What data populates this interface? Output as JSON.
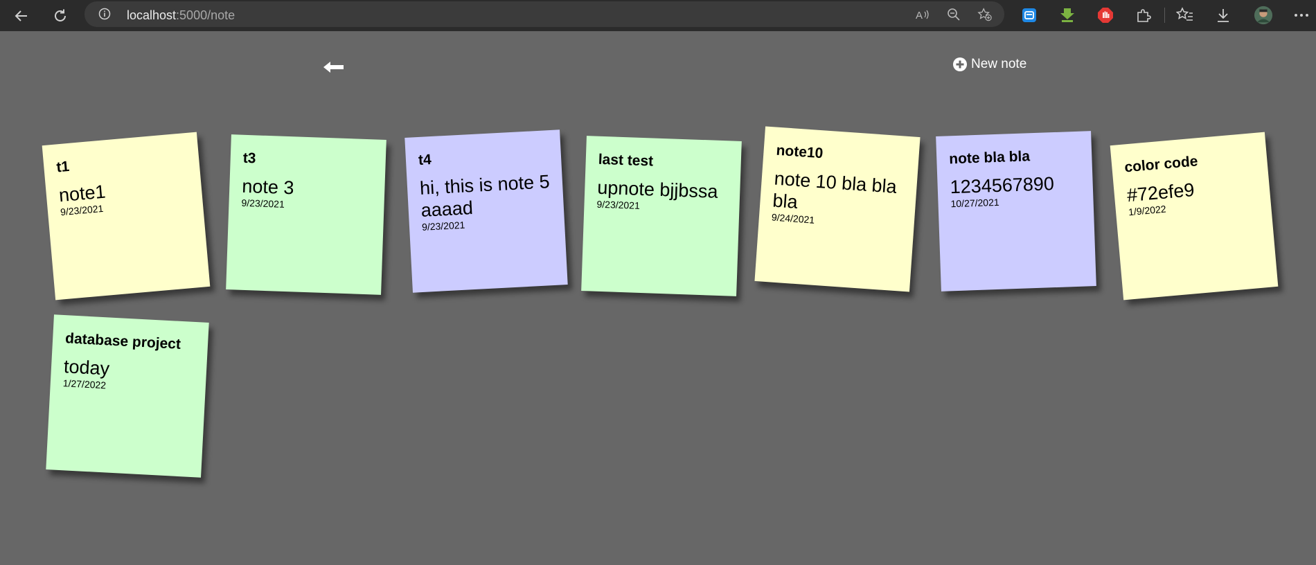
{
  "browser": {
    "url_host": "localhost",
    "url_path": ":5000/note"
  },
  "page": {
    "new_note_label": "New note"
  },
  "notes": [
    {
      "title": "t1",
      "content": "note1",
      "date": "9/23/2021",
      "color": "#ffffcc"
    },
    {
      "title": "t3",
      "content": "note 3",
      "date": "9/23/2021",
      "color": "#ccffcc"
    },
    {
      "title": "t4",
      "content": "hi, this is note 5 aaaad",
      "date": "9/23/2021",
      "color": "#ccccff"
    },
    {
      "title": "last test",
      "content": "upnote bjjbssa",
      "date": "9/23/2021",
      "color": "#ccffcc"
    },
    {
      "title": "note10",
      "content": "note 10 bla bla bla",
      "date": "9/24/2021",
      "color": "#ffffcc"
    },
    {
      "title": "note bla bla",
      "content": "1234567890",
      "date": "10/27/2021",
      "color": "#ccccff"
    },
    {
      "title": "color code",
      "content": "#72efe9",
      "date": "1/9/2022",
      "color": "#ffffcc"
    },
    {
      "title": "database project",
      "content": "today",
      "date": "1/27/2022",
      "color": "#ccffcc"
    }
  ],
  "icons": {
    "back": "arrow-left-icon",
    "reload": "reload-icon",
    "info": "info-icon",
    "read_aloud": "read-aloud-icon",
    "zoom": "zoom-out-icon",
    "favorite_add": "add-favorite-icon",
    "extensions": "puzzle-icon",
    "favorites": "favorites-icon",
    "downloads": "download-icon",
    "more": "more-icon"
  }
}
